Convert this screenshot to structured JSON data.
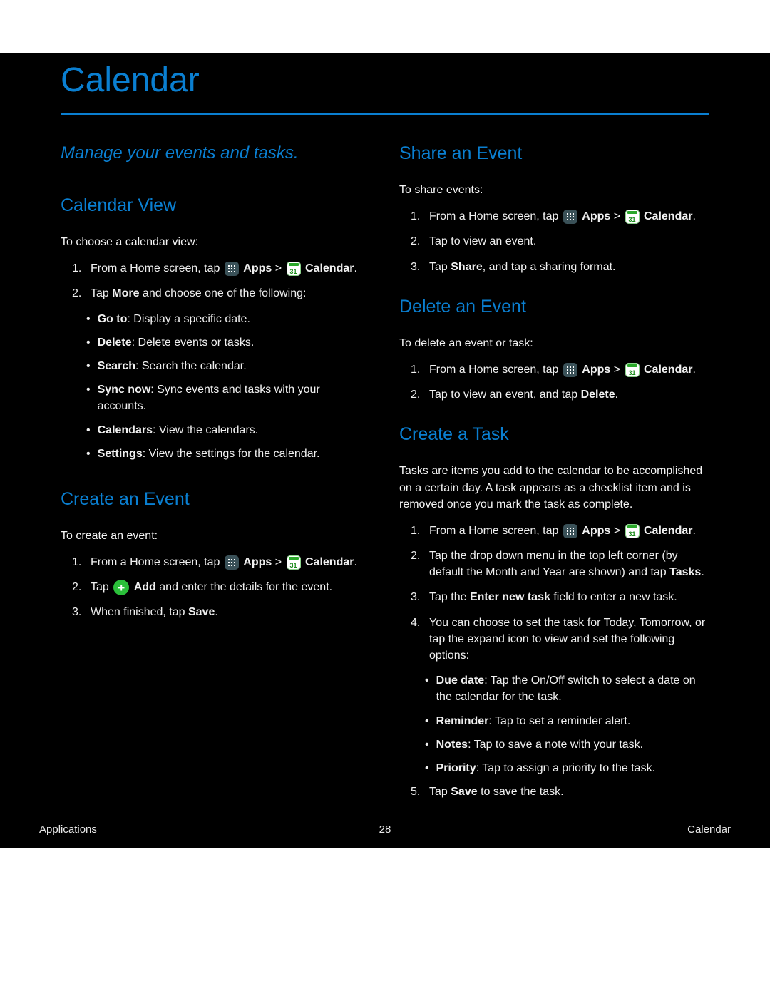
{
  "title": "Calendar",
  "subtitle": "Manage your events and tasks.",
  "left": {
    "calendar_view": {
      "heading": "Calendar View",
      "intro": "To choose a calendar view:",
      "step1_a": "From a Home screen, tap ",
      "step1_apps": "Apps",
      "step1_arrow": " > ",
      "step1_cal": "Calendar",
      "step1_end": ".",
      "step2_a": "Tap ",
      "step2_b": "More",
      "step2_c": " and choose one of the following:",
      "bullets": [
        {
          "label": "Go to",
          "tail": ": Display a specific date."
        },
        {
          "label": "Delete",
          "tail": ": Delete events or tasks."
        },
        {
          "label": "Search",
          "tail": ": Search the calendar."
        },
        {
          "label": "Sync now",
          "tail": ": Sync events and tasks with your accounts."
        },
        {
          "label": "Calendars",
          "tail": ": View the calendars."
        },
        {
          "label": "Settings",
          "tail": ": View the settings for the calendar."
        }
      ]
    },
    "create_event": {
      "heading": "Create an Event",
      "intro": "To create an event:",
      "step1_a": "From a Home screen, tap ",
      "step1_apps": "Apps",
      "step1_arrow": " > ",
      "step1_cal": "Calendar",
      "step1_end": ".",
      "step2_a": "Tap ",
      "step2_b": "Add",
      "step2_c": " and enter the details for the event.",
      "step3_a": "When finished, tap ",
      "step3_b": "Save",
      "step3_c": "."
    }
  },
  "right": {
    "share_event": {
      "heading": "Share an Event",
      "intro": "To share events:",
      "step1_a": "From a Home screen, tap ",
      "step1_apps": "Apps",
      "step1_arrow": " > ",
      "step1_cal": "Calendar",
      "step1_end": ".",
      "step2": "Tap to view an event.",
      "step3_a": "Tap ",
      "step3_b": "Share",
      "step3_c": ", and tap a sharing format."
    },
    "delete_event": {
      "heading": "Delete an Event",
      "intro": "To delete an event or task:",
      "step1_a": "From a Home screen, tap ",
      "step1_apps": "Apps",
      "step1_arrow": " > ",
      "step1_cal": "Calendar",
      "step1_end": ".",
      "step2_a": "Tap to view an event, and tap ",
      "step2_b": "Delete",
      "step2_c": "."
    },
    "create_task": {
      "heading": "Create a Task",
      "intro1": "Tasks are items you add to the calendar to be accomplished on a certain day. A task appears as a checklist item and is removed once you mark the task as complete.",
      "step1_a": "From a Home screen, tap ",
      "step1_apps": "Apps",
      "step1_arrow": " > ",
      "step1_cal": "Calendar",
      "step1_end": ".",
      "step2_a": "Tap the drop down menu in the top left corner (by default the Month and Year are shown) and tap ",
      "step2_b": "Tasks",
      "step2_c": ".",
      "step3_a": "Tap the ",
      "step3_b": "Enter new task",
      "step3_c": " field to enter a new task.",
      "step4": "You can choose to set the task for Today, Tomorrow, or tap the expand icon to view and set the following options:",
      "bullets": [
        {
          "label": "Due date",
          "tail": ": Tap the On/Off switch to select a date on the calendar for the task."
        },
        {
          "label": "Reminder",
          "tail": ": Tap to set a reminder alert."
        },
        {
          "label": "Notes",
          "tail": ": Tap to save a note with your task."
        },
        {
          "label": "Priority",
          "tail": ": Tap to assign a priority to the task."
        }
      ],
      "step5_a": "Tap ",
      "step5_b": "Save",
      "step5_c": " to save the task."
    }
  },
  "footer": {
    "left": "Applications",
    "center": "28",
    "right": "Calendar"
  }
}
